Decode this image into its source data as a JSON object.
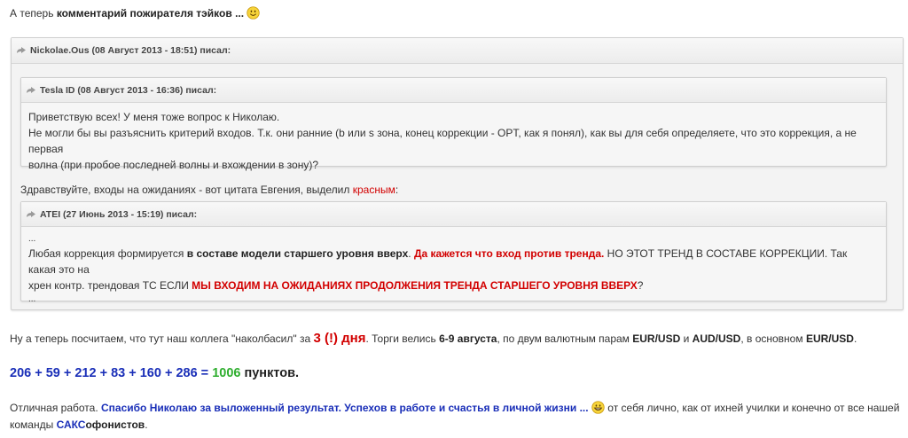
{
  "intro": {
    "prefix": "А теперь ",
    "bold": "комментарий пожирателя тэйков ...",
    "smiley": "smile-emoji"
  },
  "outer_quote": {
    "author_line": "Nickolae.Ous (08 Август 2013 - 18:51) писал:",
    "inner_quote": {
      "author_line": "Tesla ID (08 Август 2013 - 16:36) писал:",
      "line1": "Приветствую всех! У меня тоже вопрос к Николаю.",
      "line2": "Не могли бы вы разъяснить критерий входов. Т.к. они ранние (b или s зона, конец коррекции - OPT, как я понял), как вы для себя определяете, что это коррекция, а не первая",
      "line3": "волна (при пробое последней волны и вхождении в зону)?"
    },
    "reply_prefix": "Здравствуйте, входы на ожиданиях - вот цитата Евгения, выделил ",
    "reply_red": "красным",
    "reply_suffix": ":",
    "nested_quote": {
      "author_line": "ATEI (27 Июнь 2013 - 15:19) писал:",
      "dots_top": "...",
      "l1_a": "Любая коррекция формируется ",
      "l1_b": "в составе модели старшего уровня вверх",
      "l1_c": ". ",
      "l1_d": "Да кажется что вход против тренда.",
      "l1_e": " НО ЭТОТ ТРЕНД В СОСТАВЕ КОРРЕКЦИИ. Так какая это на",
      "l2_a": "хрен контр. трендовая ТС ЕСЛИ ",
      "l2_b": "МЫ ВХОДИМ НА ОЖИДАНИЯХ ПРОДОЛЖЕНИЯ ТРЕНДА СТАРШЕГО УРОВНЯ ВВЕРХ",
      "l2_c": "?",
      "dots_bottom": "..."
    }
  },
  "summary": {
    "a": "Ну а теперь посчитаем, что тут наш коллега \"наколбасил\" за ",
    "days": "3 (!) дня",
    "b": ". Торги велись ",
    "dates": "6-9 августа",
    "c": ", по двум валютным парам ",
    "pair1": "EUR/USD",
    "d": " и ",
    "pair2": "AUD/USD",
    "e": ", в основном ",
    "pair3": "EUR/USD",
    "f": "."
  },
  "total": {
    "sum": "206 + 59 + 212 + 83 + 160 + 286 =",
    "result": "1006",
    "unit": "пунктов."
  },
  "closing": {
    "a": "Отличная работа. ",
    "blue": "Спасибо Николаю за выложенный результат. Успехов в работе и счастья в личной жизни ...",
    "b": " от себя лично, как от ихней училки и конечно от все нашей",
    "c": "команды ",
    "sak": "САКС",
    "fonists": "офонистов",
    "d": ".",
    "smiley": "grin-emoji"
  },
  "colors": {
    "red": "#d20000",
    "blue": "#1a2fb8",
    "green": "#2fae2f"
  }
}
